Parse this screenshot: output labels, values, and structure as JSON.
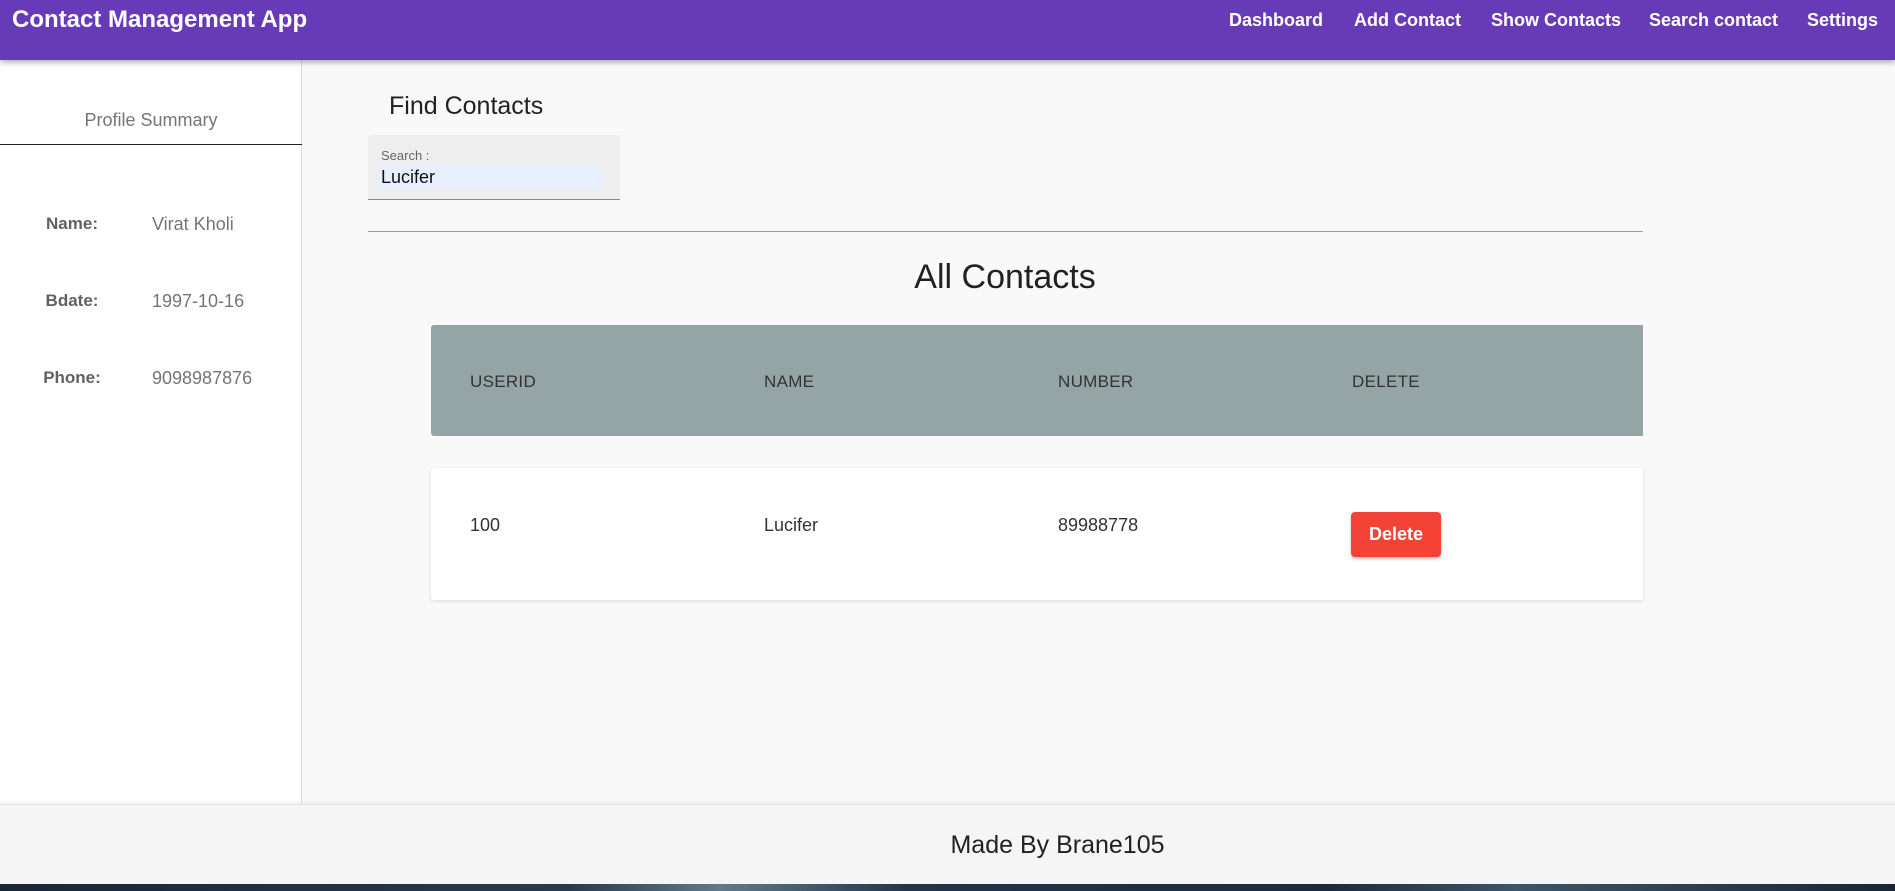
{
  "header": {
    "title": "Contact Management App",
    "nav": [
      "Dashboard",
      "Add Contact",
      "Show Contacts",
      "Search contact",
      "Settings"
    ]
  },
  "sidebar": {
    "title": "Profile Summary",
    "profile": {
      "name_label": "Name:",
      "name_value": "Virat Kholi",
      "bdate_label": "Bdate:",
      "bdate_value": "1997-10-16",
      "phone_label": "Phone:",
      "phone_value": "9098987876"
    }
  },
  "main": {
    "find_title": "Find Contacts",
    "search": {
      "label": "Search :",
      "value": "Lucifer"
    },
    "list_title": "All Contacts",
    "columns": [
      "USERID",
      "NAME",
      "NUMBER",
      "DELETE"
    ],
    "rows": [
      {
        "userid": "100",
        "name": "Lucifer",
        "number": "89988778",
        "delete_label": "Delete"
      }
    ]
  },
  "footer": {
    "text": "Made By Brane105"
  },
  "colors": {
    "header_bg": "#673ab7",
    "table_header_bg": "#95a5a6",
    "delete_button": "#f44336"
  }
}
